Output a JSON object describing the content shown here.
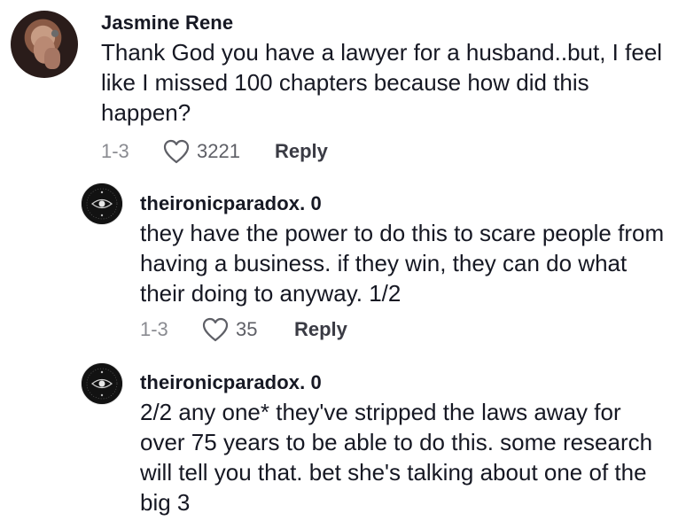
{
  "comments": [
    {
      "username": "Jasmine Rene",
      "lines": [
        "Thank God you have a lawyer for a husband..but, I feel",
        "like I missed 100 chapters because how did this",
        "happen?"
      ],
      "date": "1-3",
      "likes": "3221",
      "reply_label": "Reply",
      "avatar_icon": "user-photo-avatar"
    },
    {
      "username": "theironicparadox. 0",
      "lines": [
        "they have the power to do this to scare people from",
        "having a business. if they win, they can do what",
        "their doing to anyway. 1/2"
      ],
      "date": "1-3",
      "likes": "35",
      "reply_label": "Reply",
      "avatar_icon": "eye-emblem-avatar"
    },
    {
      "username": "theironicparadox. 0",
      "lines": [
        "2/2 any one* they've stripped the laws away for",
        "over 75 years to be able to do this. some research",
        "will tell you that. bet she's talking about one of the",
        "big 3"
      ],
      "avatar_icon": "eye-emblem-avatar"
    }
  ],
  "colors": {
    "text": "#161823",
    "secondary": "#8a8b91",
    "icon": "#5e5f66"
  }
}
